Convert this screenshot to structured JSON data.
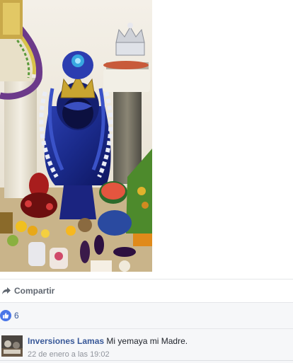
{
  "post": {
    "photo_icon": "altar-photo",
    "share_label": "Compartir",
    "share_icon": "share-arrow-icon",
    "like_icon": "thumbs-up-icon",
    "like_count": "6",
    "like_color": "#4a76e8",
    "link_color": "#385898"
  },
  "comment": {
    "author": "Inversiones Lamas",
    "text": "Mi yemaya mi Madre.",
    "timestamp": "22 de enero a las 19:02"
  }
}
